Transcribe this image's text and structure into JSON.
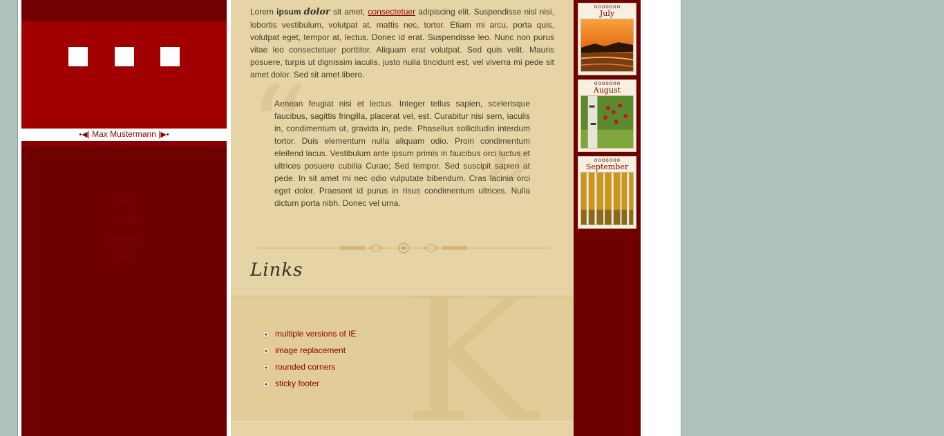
{
  "author_nav": {
    "prev_arrow": "◀",
    "name": "Max Mustermann",
    "next_arrow": "▶"
  },
  "nav": {
    "items": [
      {
        "label": "Home"
      },
      {
        "label": "About"
      },
      {
        "label": "Contact"
      },
      {
        "label": "Links"
      }
    ]
  },
  "intro": {
    "w1": "Lorem ",
    "w2": "ipsum",
    "w3": "dolor",
    "w4": " sit amet, ",
    "link": "consectetuer",
    "rest": " adipiscing elit. Suspendisse nisl nisi, lobortis vestibulum, volutpat at, mattis nec, tortor. Etiam mi arcu, porta quis, volutpat eget, tempor at, lectus. Donec id erat. Suspendisse leo. Nunc non purus vitae leo consectetuer porttitor. Aliquam erat volutpat. Sed quis velit. Mauris posuere, turpis ut dignissim iaculis, justo nulla tincidunt est, vel viverra mi pede sit amet dolor. Sed sit amet libero."
  },
  "quote": {
    "text": "Aenean feugiat nisi et lectus. Integer tellus sapien, scelerisque faucibus, sagittis fringilla, placerat vel, est. Curabitur nisi sem, iaculis in, condimentum ut, gravida in, pede. Phasellus sollicitudin interdum tortor. Duis elementum nulla aliquam odio. Proin condimentum eleifend lacus. Vestibulum ante ipsum primis in faucibus orci luctus et ultrices posuere cubilia Curae; Sed tempor. Sed suscipit sapien at pede. In sit amet mi nec odio vulputate bibendum. Cras lacinia orci eget dolor. Praesent id purus in risus condimentum ultrices. Nulla dictum porta nibh. Donec vel urna."
  },
  "links_section": {
    "heading": "Links",
    "items": [
      {
        "label": "multiple versions of IE"
      },
      {
        "label": "image replacement"
      },
      {
        "label": "rounded corners"
      },
      {
        "label": "sticky footer"
      }
    ]
  },
  "calendar": {
    "months": [
      {
        "label": "July",
        "photo": "sunset-lake-photo"
      },
      {
        "label": "August",
        "photo": "birch-berries-photo"
      },
      {
        "label": "September",
        "photo": "autumn-forest-photo"
      }
    ]
  },
  "colors": {
    "accent_red": "#8b0000",
    "header_red": "#a10000",
    "sidebar_dark": "#6e0000",
    "content_tan": "#e6d4a6",
    "page_bg": "#b0c0ba"
  }
}
